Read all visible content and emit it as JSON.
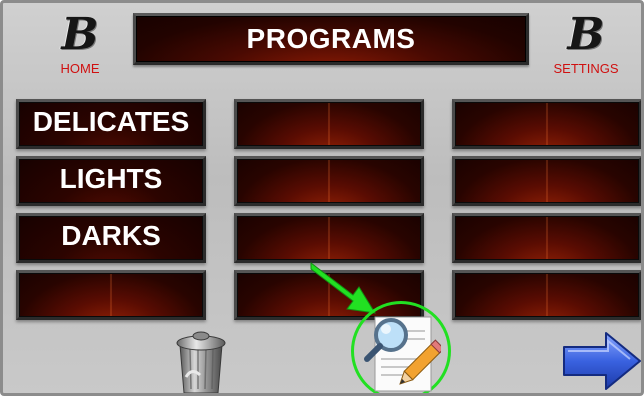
{
  "header": {
    "title": "PROGRAMS",
    "home": {
      "logo": "B",
      "label": "HOME"
    },
    "settings": {
      "logo": "B",
      "label": "SETTINGS"
    }
  },
  "programs": {
    "col1": [
      "DELICATES",
      "LIGHTS",
      "DARKS",
      ""
    ],
    "col2": [
      "",
      "",
      "",
      ""
    ],
    "col3": [
      "",
      "",
      "",
      ""
    ]
  },
  "toolbar": {
    "delete_icon": "trash-can-icon",
    "edit_icon": "magnifier-pencil-document-icon",
    "next_icon": "right-arrow-icon"
  },
  "annotation": {
    "pointer_color": "#22e022",
    "highlight_color": "#22e022"
  },
  "colors": {
    "button_dark_red": "#4a0a02",
    "caption_red": "#d01010",
    "background_gray": "#c4c4c4"
  }
}
